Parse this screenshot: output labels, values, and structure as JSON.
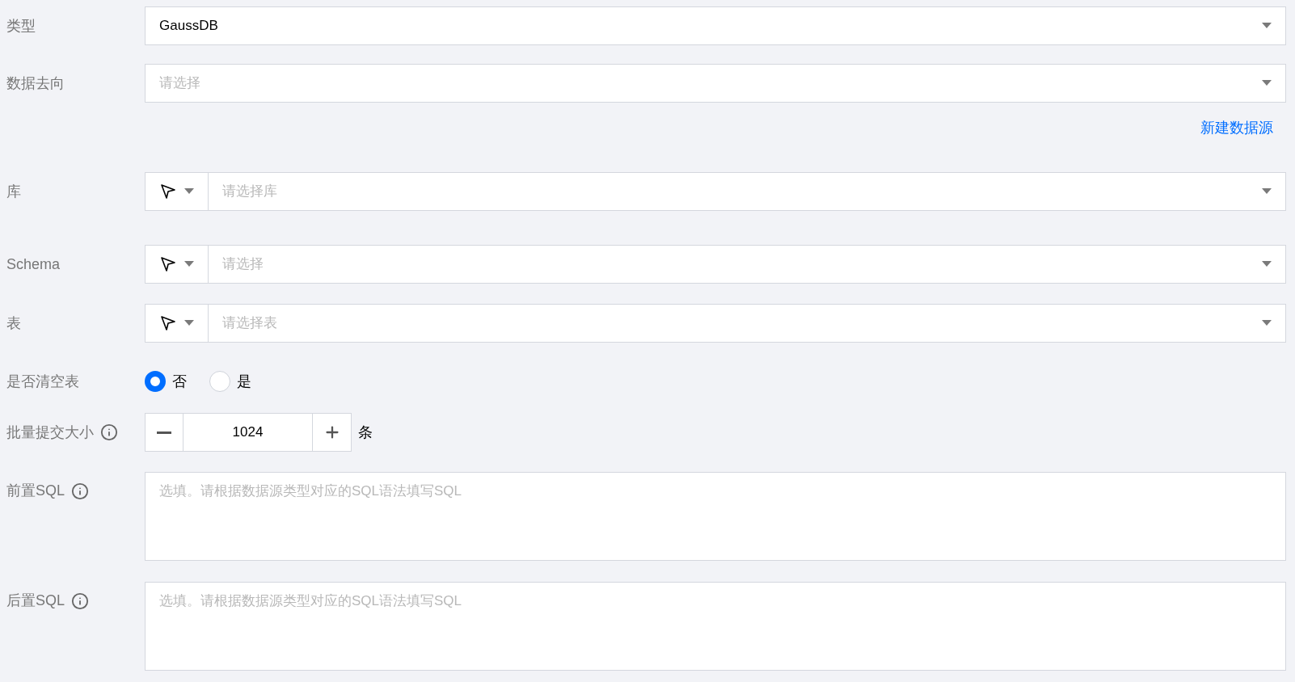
{
  "fields": [
    {
      "kind": "select",
      "label": "类型",
      "value": "GaussDB"
    },
    {
      "kind": "select",
      "label": "数据去向",
      "placeholder": "请选择",
      "link": "新建数据源"
    },
    {
      "kind": "picker_select",
      "label": "库",
      "placeholder": "请选择库"
    },
    {
      "kind": "picker_select",
      "label": "Schema",
      "placeholder": "请选择"
    },
    {
      "kind": "picker_select",
      "label": "表",
      "placeholder": "请选择表"
    },
    {
      "kind": "radio",
      "label": "是否清空表",
      "options": [
        {
          "label": "否",
          "selected": true
        },
        {
          "label": "是",
          "selected": false
        }
      ]
    },
    {
      "kind": "stepper",
      "label": "批量提交大小",
      "info": true,
      "value": "1024",
      "unit": "条"
    },
    {
      "kind": "textarea",
      "label": "前置SQL",
      "info": true,
      "placeholder": "选填。请根据数据源类型对应的SQL语法填写SQL"
    },
    {
      "kind": "textarea",
      "label": "后置SQL",
      "info": true,
      "placeholder": "选填。请根据数据源类型对应的SQL语法填写SQL"
    }
  ]
}
